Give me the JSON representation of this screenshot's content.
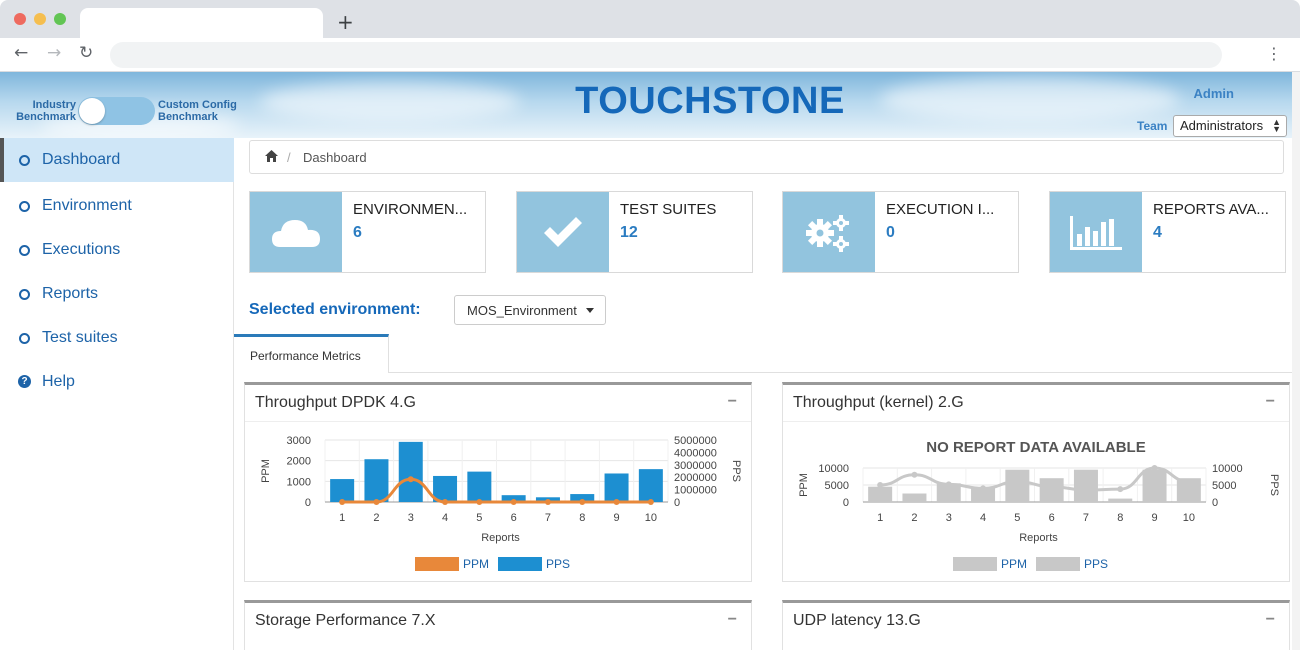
{
  "header": {
    "toggle_left_line1": "Industry",
    "toggle_left_line2": "Benchmark",
    "toggle_right_line1": "Custom Config",
    "toggle_right_line2": "Benchmark",
    "brand": "TOUCHSTONE",
    "admin": "Admin",
    "team_label": "Team",
    "team_value": "Administrators"
  },
  "sidebar": {
    "items": [
      {
        "label": "Dashboard",
        "icon": "circle-icon",
        "active": true
      },
      {
        "label": "Environment",
        "icon": "circle-icon"
      },
      {
        "label": "Executions",
        "icon": "circle-icon"
      },
      {
        "label": "Reports",
        "icon": "circle-icon"
      },
      {
        "label": "Test suites",
        "icon": "circle-icon"
      },
      {
        "label": "Help",
        "icon": "help-icon"
      }
    ]
  },
  "breadcrumb": {
    "sep": "/",
    "current": "Dashboard"
  },
  "stats": [
    {
      "title": "ENVIRONMEN...",
      "value": "6",
      "icon": "cloud-icon"
    },
    {
      "title": "TEST SUITES",
      "value": "12",
      "icon": "checkmark-icon"
    },
    {
      "title": "EXECUTION I...",
      "value": "0",
      "icon": "gears-icon"
    },
    {
      "title": "REPORTS AVA...",
      "value": "4",
      "icon": "bar-chart-icon"
    }
  ],
  "environment": {
    "label": "Selected environment:",
    "value": "MOS_Environment"
  },
  "tabs": {
    "active": "Performance Metrics"
  },
  "panels": [
    {
      "title": "Throughput DPDK 4.G",
      "collapse": "−"
    },
    {
      "title": "Throughput (kernel) 2.G",
      "collapse": "−"
    },
    {
      "title": "Storage Performance 7.X",
      "collapse": "−"
    },
    {
      "title": "UDP latency 13.G",
      "collapse": "−"
    }
  ],
  "colors": {
    "brand": "#1568b9",
    "accent": "#2b7cc1",
    "bar_blue": "#1d8fd1",
    "line_orange": "#e8883a",
    "grey": "#c8c8c8"
  },
  "chart_data": [
    {
      "type": "bar",
      "categories": [
        "1",
        "2",
        "3",
        "4",
        "5",
        "6",
        "7",
        "8",
        "9",
        "10"
      ],
      "xlabel": "Reports",
      "ylabel": "PPM",
      "y2label": "PPS",
      "ylim": [
        0,
        3000
      ],
      "y2lim": [
        0,
        5000000
      ],
      "yticks": [
        "0",
        "1000",
        "2000",
        "3000"
      ],
      "y2ticks": [
        "0",
        "1000000",
        "2000000",
        "3000000",
        "4000000",
        "5000000"
      ],
      "series": [
        {
          "name": "PPM",
          "kind": "line",
          "color": "#e8883a",
          "values": [
            0,
            0,
            1100,
            0,
            0,
            0,
            0,
            0,
            0,
            0
          ]
        },
        {
          "name": "PPS",
          "kind": "bar",
          "color": "#1d8fd1",
          "values": [
            1850000,
            3450000,
            4850000,
            2100000,
            2450000,
            550000,
            380000,
            640000,
            2300000,
            2650000
          ]
        }
      ],
      "legend": "bottom"
    },
    {
      "type": "bar",
      "title": "NO REPORT DATA AVAILABLE",
      "categories": [
        "1",
        "2",
        "3",
        "4",
        "5",
        "6",
        "7",
        "8",
        "9",
        "10"
      ],
      "xlabel": "Reports",
      "ylabel": "PPM",
      "y2label": "PPS",
      "ylim": [
        0,
        10000
      ],
      "y2lim": [
        0,
        10000
      ],
      "yticks": [
        "0",
        "5000",
        "10000"
      ],
      "y2ticks": [
        "0",
        "5000",
        "10000"
      ],
      "series": [
        {
          "name": "PPM",
          "kind": "line",
          "color": "#c8c8c8",
          "values": [
            5000,
            8000,
            5200,
            4000,
            6000,
            4500,
            3500,
            3800,
            10000,
            6000
          ]
        },
        {
          "name": "PPS",
          "kind": "bar",
          "color": "#c8c8c8",
          "values": [
            4500,
            2500,
            5500,
            4000,
            9500,
            7000,
            9500,
            1000,
            9500,
            7000
          ]
        }
      ],
      "legend": "bottom"
    }
  ]
}
